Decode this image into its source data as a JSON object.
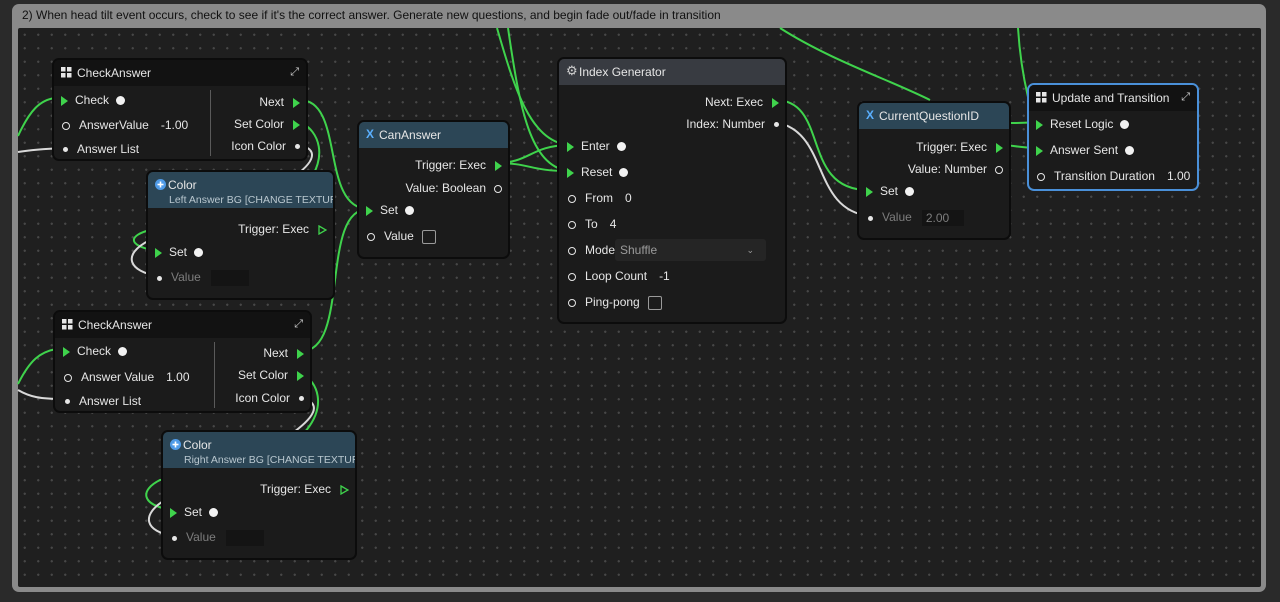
{
  "group": {
    "title": "2) When head tilt event occurs, check to see if it's the correct answer. Generate new questions, and begin fade out/fade in transition"
  },
  "check_answer_1": {
    "title": "CheckAnswer",
    "check": "Check",
    "answer_value_label": "AnswerValue",
    "answer_value": "-1.00",
    "answer_list": "Answer List",
    "next": "Next",
    "set_color": "Set Color",
    "icon_color": "Icon Color"
  },
  "color_left": {
    "title": "Color",
    "subtitle": "Left Answer BG [CHANGE TEXTURE]",
    "trigger": "Trigger: Exec",
    "set": "Set",
    "value": "Value"
  },
  "check_answer_2": {
    "title": "CheckAnswer",
    "check": "Check",
    "answer_value_label": "Answer Value",
    "answer_value": "1.00",
    "answer_list": "Answer List",
    "next": "Next",
    "set_color": "Set Color",
    "icon_color": "Icon Color"
  },
  "color_right": {
    "title": "Color",
    "subtitle": "Right Answer BG [CHANGE TEXTURE]",
    "trigger": "Trigger: Exec",
    "set": "Set",
    "value": "Value"
  },
  "can_answer": {
    "title": "CanAnswer",
    "trigger": "Trigger: Exec",
    "value_type": "Value: Boolean",
    "set": "Set",
    "value": "Value",
    "checked": false
  },
  "index_generator": {
    "title": "Index Generator",
    "next": "Next: Exec",
    "index": "Index: Number",
    "enter": "Enter",
    "reset": "Reset",
    "from_label": "From",
    "from_value": "0",
    "to_label": "To",
    "to_value": "4",
    "mode_label": "Mode",
    "mode_value": "Shuffle",
    "loop_label": "Loop Count",
    "loop_value": "-1",
    "pingpong_label": "Ping-pong",
    "pingpong_checked": false
  },
  "current_question": {
    "title": "CurrentQuestionID",
    "trigger": "Trigger: Exec",
    "value_type": "Value: Number",
    "set": "Set",
    "value_label": "Value",
    "value": "2.00"
  },
  "update_transition": {
    "title": "Update and Transition",
    "reset_logic": "Reset Logic",
    "answer_sent": "Answer Sent",
    "transition_duration_label": "Transition Duration",
    "transition_duration": "1.00"
  },
  "icons": {
    "logic_node": "grid-icon",
    "variable_node": "x-icon",
    "color_node": "plus-circle-icon",
    "generator_node": "gear-icon",
    "expand": "expand-icon",
    "dropdown": "chevron-down-icon"
  },
  "colors": {
    "exec_wire": "#3fd34c",
    "data_wire": "#d9d9d9",
    "selected_border": "#4a90d9",
    "variable_header": "#2c4656"
  }
}
